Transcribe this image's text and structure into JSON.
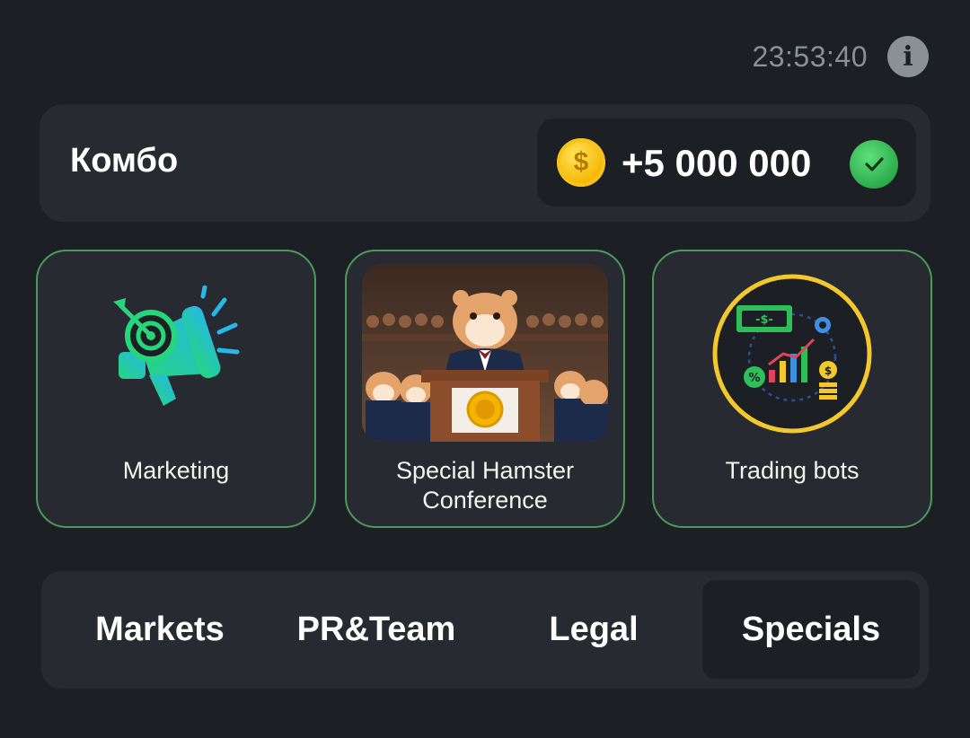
{
  "header": {
    "timer": "23:53:40",
    "info_icon": "info-icon"
  },
  "combo": {
    "title": "Комбо",
    "reward": "+5 000 000",
    "coin_icon": "coin-icon",
    "status_icon": "check-icon",
    "colors": {
      "check": "#2fb04f",
      "coin": "#f5b400",
      "card_border": "#4c9a5b"
    }
  },
  "cards": [
    {
      "label": "Marketing",
      "icon": "megaphone-target-icon"
    },
    {
      "label": "Special Hamster Conference",
      "icon": "hamster-conference-image"
    },
    {
      "label": "Trading bots",
      "icon": "trading-bots-icon"
    }
  ],
  "tabs": [
    {
      "label": "Markets",
      "active": false
    },
    {
      "label": "PR&Team",
      "active": false
    },
    {
      "label": "Legal",
      "active": false
    },
    {
      "label": "Specials",
      "active": true
    }
  ]
}
